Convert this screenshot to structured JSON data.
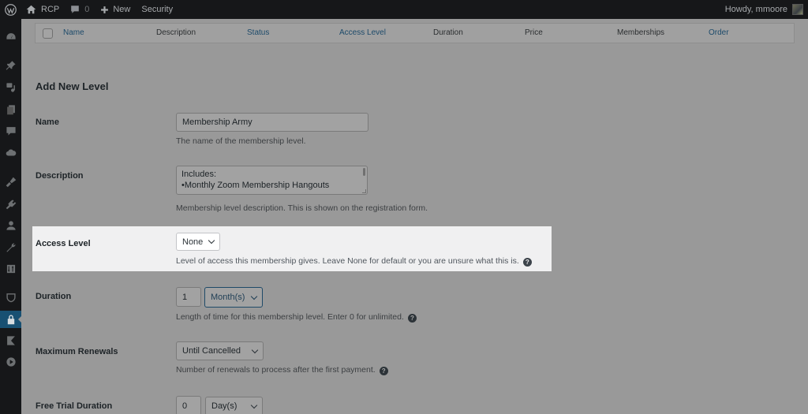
{
  "adminbar": {
    "site_name": "RCP",
    "comments_count": "0",
    "new_label": "New",
    "security_label": "Security",
    "greeting": "Howdy, mmoore",
    "icons": [
      "wordpress-logo-icon",
      "home-icon",
      "comment-icon",
      "plus-icon",
      "avatar"
    ]
  },
  "sidebar": {
    "items": [
      {
        "icon": "dashboard-icon"
      },
      {
        "icon": "pin-icon"
      },
      {
        "icon": "media-icon"
      },
      {
        "icon": "pages-icon"
      },
      {
        "icon": "comments-icon"
      },
      {
        "icon": "cloud-icon"
      },
      {
        "icon": "appearance-icon"
      },
      {
        "icon": "plugins-icon"
      },
      {
        "icon": "users-icon"
      },
      {
        "icon": "tools-icon"
      },
      {
        "icon": "settings-icon"
      },
      {
        "icon": "shield-icon"
      },
      {
        "icon": "lock-icon",
        "active": true
      },
      {
        "icon": "k-logo-icon"
      },
      {
        "icon": "play-icon"
      }
    ]
  },
  "table": {
    "columns": [
      {
        "label": "Name",
        "link": true
      },
      {
        "label": "Description",
        "link": false
      },
      {
        "label": "Status",
        "link": true
      },
      {
        "label": "Access Level",
        "link": true
      },
      {
        "label": "Duration",
        "link": false
      },
      {
        "label": "Price",
        "link": false
      },
      {
        "label": "Memberships",
        "link": false
      },
      {
        "label": "Order",
        "link": true
      }
    ]
  },
  "form": {
    "title": "Add New Level",
    "name": {
      "label": "Name",
      "value": "Membership Army",
      "description": "The name of the membership level."
    },
    "description": {
      "label": "Description",
      "line1": "Includes:",
      "line2": "•Monthly Zoom Membership Hangouts",
      "description": "Membership level description. This is shown on the registration form."
    },
    "access_level": {
      "label": "Access Level",
      "selected": "None",
      "description": "Level of access this membership gives. Leave None for default or you are unsure what this is."
    },
    "duration": {
      "label": "Duration",
      "value": "1",
      "unit": "Month(s)",
      "description": "Length of time for this membership level. Enter 0 for unlimited."
    },
    "max_renewals": {
      "label": "Maximum Renewals",
      "selected": "Until Cancelled",
      "description": "Number of renewals to process after the first payment."
    },
    "free_trial": {
      "label": "Free Trial Duration",
      "value": "0",
      "unit": "Day(s)"
    },
    "help_glyph": "?"
  }
}
